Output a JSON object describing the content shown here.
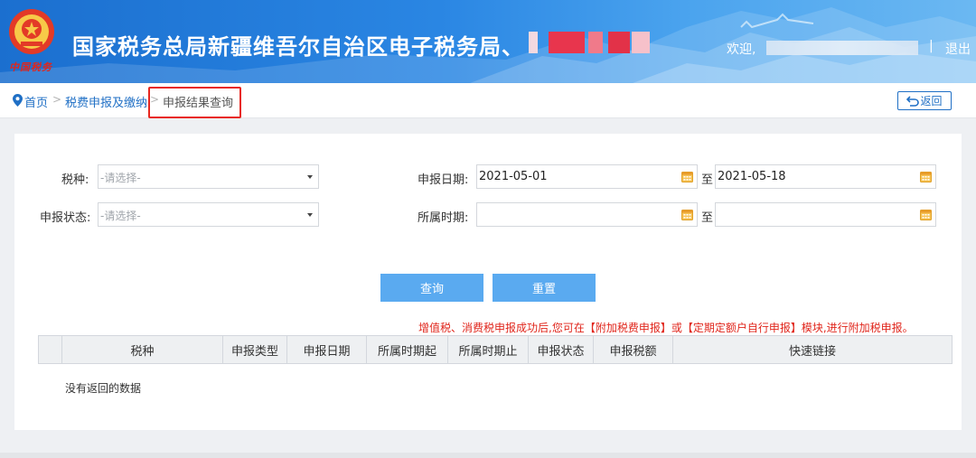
{
  "header": {
    "site_title": "国家税务总局新疆维吾尔自治区电子税务局",
    "title_separator": "、",
    "welcome_label": "欢迎,",
    "divider": "|",
    "logout_label": "退出",
    "emblem_caption": "中国税务"
  },
  "breadcrumb": {
    "home_label": "首页",
    "separator": ">",
    "parent_label": "税费申报及缴纳",
    "current_label": "申报结果查询",
    "back_label": "返回"
  },
  "form": {
    "tax_type": {
      "label": "税种:",
      "placeholder": "-请选择-"
    },
    "declare_status": {
      "label": "申报状态:",
      "placeholder": "-请选择-"
    },
    "declare_date": {
      "label": "申报日期:",
      "start_value": "2021-05-01",
      "end_value": "2021-05-18"
    },
    "period": {
      "label": "所属时期:",
      "start_value": "",
      "end_value": ""
    },
    "to_label": "至",
    "query_button": "查询",
    "reset_button": "重置"
  },
  "notice": "增值税、消费税申报成功后,您可在【附加税费申报】或【定期定额户自行申报】模块,进行附加税申报。",
  "table": {
    "columns": [
      "",
      "税种",
      "申报类型",
      "申报日期",
      "所属时期起",
      "所属时期止",
      "申报状态",
      "申报税额",
      "快速链接"
    ],
    "rows": [],
    "empty_message": "没有返回的数据"
  },
  "colors": {
    "header_blue": "#2a86e3",
    "link_blue": "#1f6fc5",
    "button_blue": "#5aaaf0",
    "notice_red": "#e0251b",
    "highlight_red": "#e8271f"
  },
  "icons": {
    "emblem": "tax-emblem-icon",
    "location": "location-pin-icon",
    "back": "return-arrow-icon",
    "calendar": "calendar-icon",
    "dropdown": "chevron-down-icon"
  }
}
